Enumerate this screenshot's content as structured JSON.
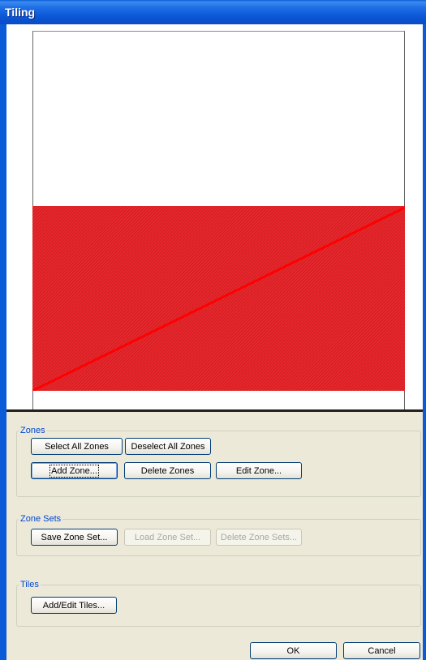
{
  "window": {
    "title": "Tiling"
  },
  "colors": {
    "zone_fill": "#e8262b",
    "zone_line": "#ff0000"
  },
  "zones": {
    "label": "Zones",
    "select_all": "Select All Zones",
    "deselect_all": "Deselect All Zones",
    "add_zone": "Add Zone...",
    "delete_zones": "Delete Zones",
    "edit_zone": "Edit Zone..."
  },
  "zone_sets": {
    "label": "Zone Sets",
    "save": "Save Zone Set...",
    "load": "Load Zone Set...",
    "delete": "Delete Zone Sets..."
  },
  "tiles": {
    "label": "Tiles",
    "add_edit": "Add/Edit Tiles..."
  },
  "dialog": {
    "ok": "OK",
    "cancel": "Cancel"
  }
}
